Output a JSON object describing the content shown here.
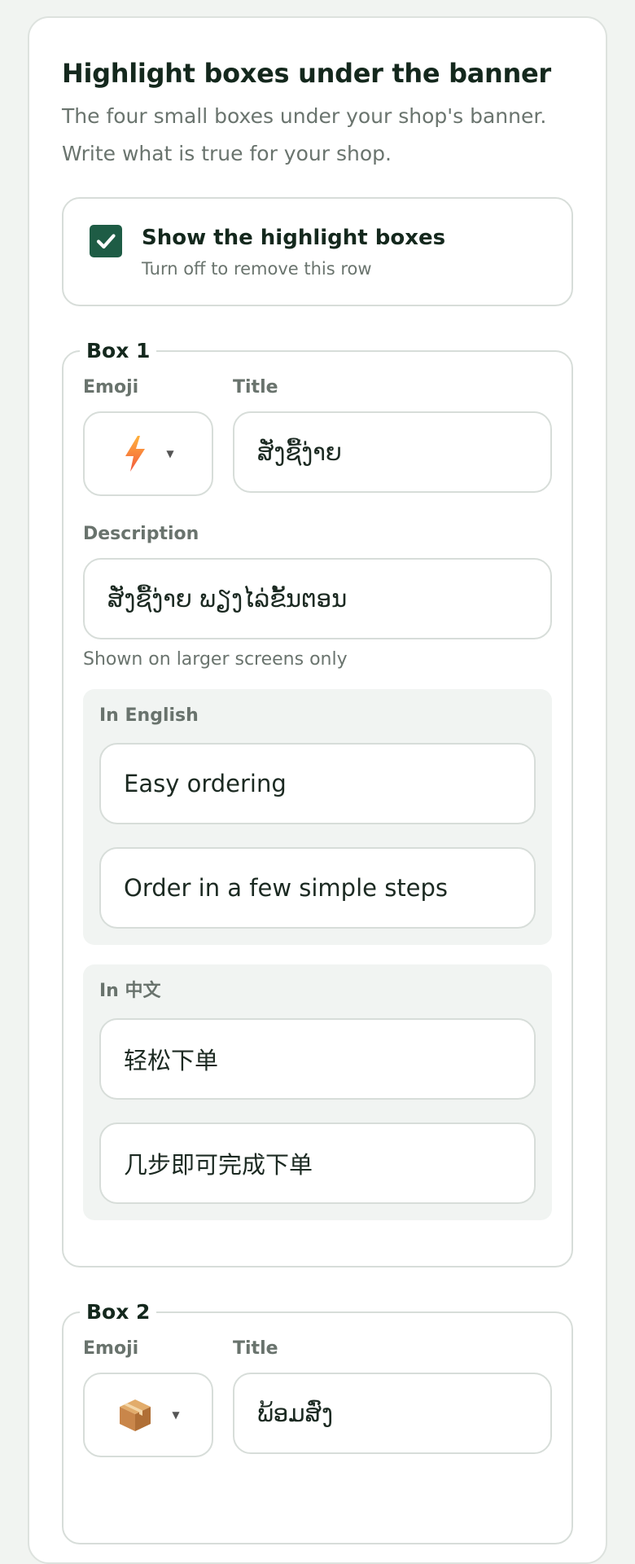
{
  "section": {
    "title": "Highlight boxes under the banner",
    "subtitle_line1": "The four small boxes under your shop's banner.",
    "subtitle_line2": "Write what is true for your shop."
  },
  "toggle": {
    "label": "Show the highlight boxes",
    "hint": "Turn off to remove this row",
    "checked": true
  },
  "labels": {
    "emoji": "Emoji",
    "title": "Title",
    "description": "Description",
    "description_hint": "Shown on larger screens only",
    "in_english": "In English",
    "in_chinese": "In 中文"
  },
  "boxes": [
    {
      "legend": "Box 1",
      "emoji": "lightning-emoji",
      "title": "ສັ່ງຊື້ງ່າຍ",
      "description": "ສັ່ງຊື້ງ່າຍ ພຽງໄລ່ຂັ້ນຕອນ",
      "en_title": "Easy ordering",
      "en_description": "Order in a few simple steps",
      "zh_title": "轻松下单",
      "zh_description": "几步即可完成下单"
    },
    {
      "legend": "Box 2",
      "emoji": "package-emoji",
      "title": "ພ້ອມສົ່ງ"
    }
  ],
  "colors": {
    "accent": "#1e5c45",
    "border": "#d7ddd9",
    "panel": "#f1f4f2"
  }
}
